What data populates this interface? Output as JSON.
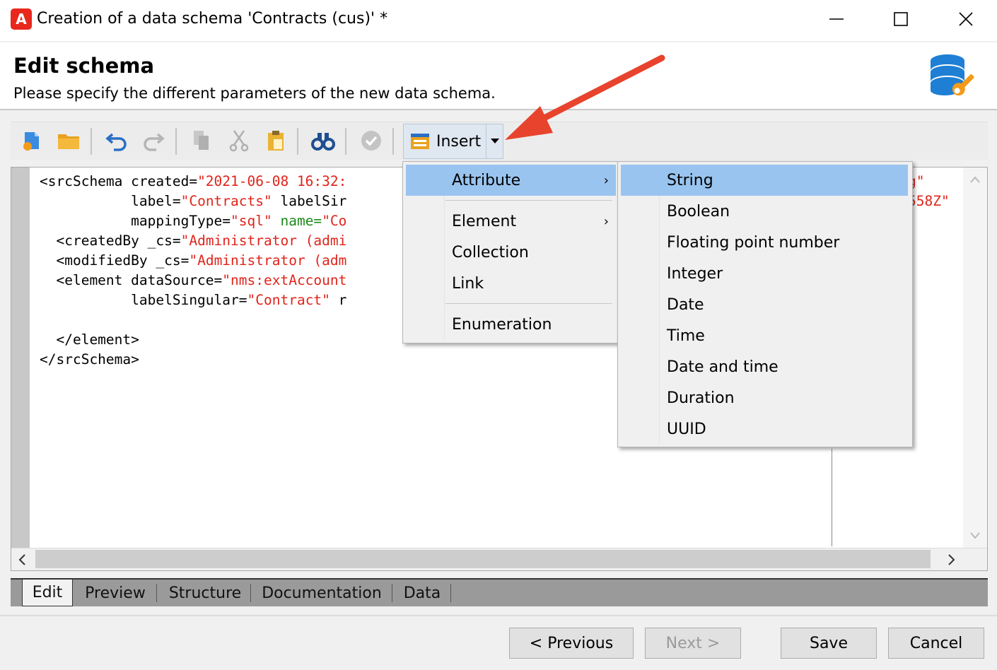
{
  "window": {
    "app_logo": "A",
    "title": "Creation of a data schema 'Contracts (cus)' *",
    "minimize_icon": "minimize-icon",
    "maximize_icon": "maximize-icon",
    "close_icon": "close-icon"
  },
  "header": {
    "title": "Edit schema",
    "description": "Please specify the different parameters of the new data schema.",
    "icon": "database-wrench-icon"
  },
  "toolbar": {
    "insert_label": "Insert",
    "icons": [
      "new-icon",
      "open-folder-icon",
      "undo-icon",
      "redo-icon",
      "copy-icon",
      "cut-icon",
      "paste-icon",
      "find-icon",
      "validate-icon",
      "insert-icon"
    ]
  },
  "editor": {
    "lines": [
      {
        "prefix": "<srcSchema ",
        "a1": "created=",
        "v1": "\"2021-06-08 16:32:",
        "a2": "",
        "v2": ""
      },
      {
        "prefix": "           ",
        "a1": "label=",
        "v1": "\"Contracts\"",
        "a2": " labelSir",
        "v2": ""
      },
      {
        "prefix": "           ",
        "a1": "mappingType=",
        "v1": "\"sql\"",
        "a2": " name=",
        "v2": "\"Co"
      },
      {
        "prefix": "  <createdBy ",
        "a1": "_cs=",
        "v1": "\"Administrator (admi",
        "a2": "",
        "v2": ""
      },
      {
        "prefix": "  <modifiedBy ",
        "a1": "_cs=",
        "v1": "\"Administrator (adm",
        "a2": "",
        "v2": ""
      },
      {
        "prefix": "  <element ",
        "a1": "dataSource=",
        "v1": "\"nms:extAccount",
        "a2": "",
        "v2": ""
      },
      {
        "prefix": "           ",
        "a1": "labelSingular=",
        "v1": "\"Contract\"",
        "a2": " r",
        "v2": ""
      },
      {
        "prefix": "",
        "a1": "",
        "v1": "",
        "a2": "",
        "v2": ""
      },
      {
        "prefix": "  </element>",
        "a1": "",
        "v1": "",
        "a2": "",
        "v2": ""
      },
      {
        "prefix": "</srcSchema>",
        "a1": "",
        "v1": "",
        "a2": "",
        "v2": ""
      }
    ],
    "right_fragment_1": "g\"",
    "right_fragment_2": "558Z\""
  },
  "tabs": [
    "Edit",
    "Preview",
    "Structure",
    "Documentation",
    "Data"
  ],
  "buttons": {
    "previous": "< Previous",
    "next": "Next >",
    "save": "Save",
    "cancel": "Cancel"
  },
  "insert_menu": {
    "items": [
      "Attribute",
      "Element",
      "Collection",
      "Link",
      "Enumeration"
    ],
    "highlighted": "Attribute"
  },
  "attribute_submenu": {
    "items": [
      "String",
      "Boolean",
      "Floating point number",
      "Integer",
      "Date",
      "Time",
      "Date and time",
      "Duration",
      "UUID"
    ],
    "highlighted": "String"
  },
  "colors": {
    "attribute_value": "#e0241b",
    "menu_highlight": "#99c4ef",
    "callout_arrow": "#e8432d"
  }
}
